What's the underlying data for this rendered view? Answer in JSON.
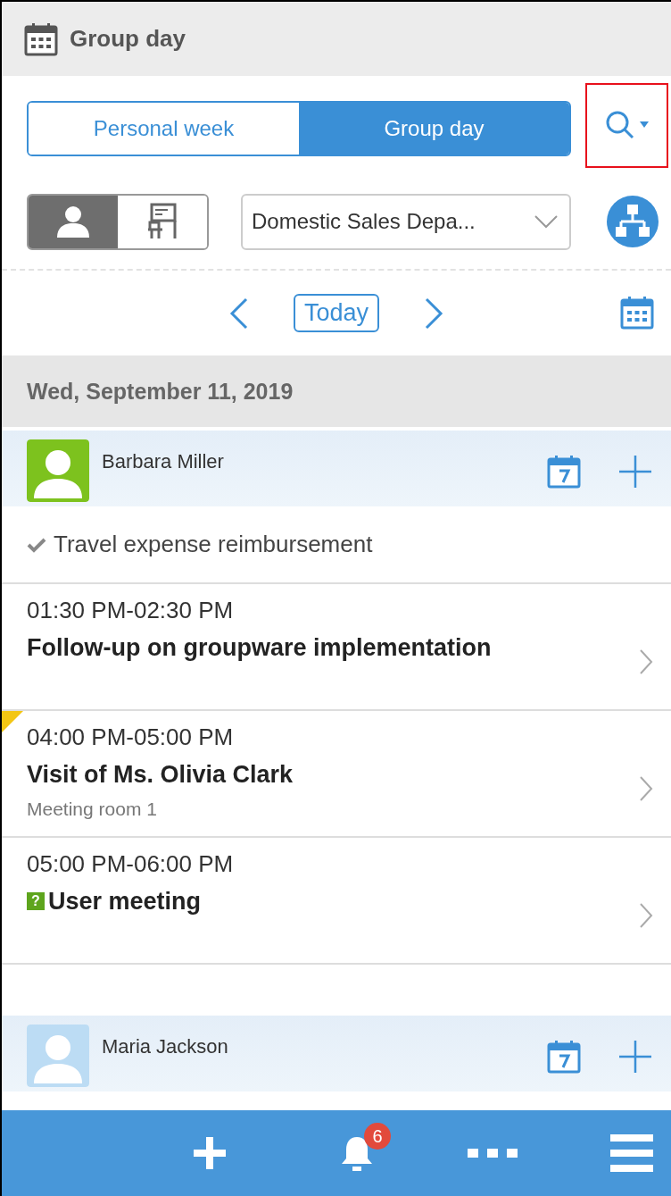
{
  "header": {
    "title": "Group day"
  },
  "view_tabs": [
    {
      "label": "Personal week",
      "selected": false
    },
    {
      "label": "Group day",
      "selected": true
    }
  ],
  "search": {
    "highlighted": true
  },
  "target_toggle": [
    {
      "kind": "user",
      "selected": true
    },
    {
      "kind": "facility",
      "selected": false
    }
  ],
  "group_select": {
    "value": "Domestic Sales Depa..."
  },
  "date_nav": {
    "today": "Today"
  },
  "date": "Wed, September 11, 2019",
  "users": [
    {
      "name": "Barbara Miller",
      "kind": "active",
      "tasks": [
        {
          "title": "Travel expense reimbursement",
          "done": true
        }
      ],
      "events": [
        {
          "time": "01:30 PM-02:30 PM",
          "title": "Follow-up on groupware implementation",
          "flagged": false
        },
        {
          "time": "04:00 PM-05:00 PM",
          "title": "Visit of Ms. Olivia Clark",
          "location": "Meeting room 1",
          "flagged": true
        },
        {
          "time": "05:00 PM-06:00 PM",
          "title": "User meeting",
          "badge": "?",
          "flagged": false
        }
      ]
    },
    {
      "name": "Maria Jackson",
      "kind": "inactive"
    }
  ],
  "footer": {
    "notification_count": "6"
  }
}
